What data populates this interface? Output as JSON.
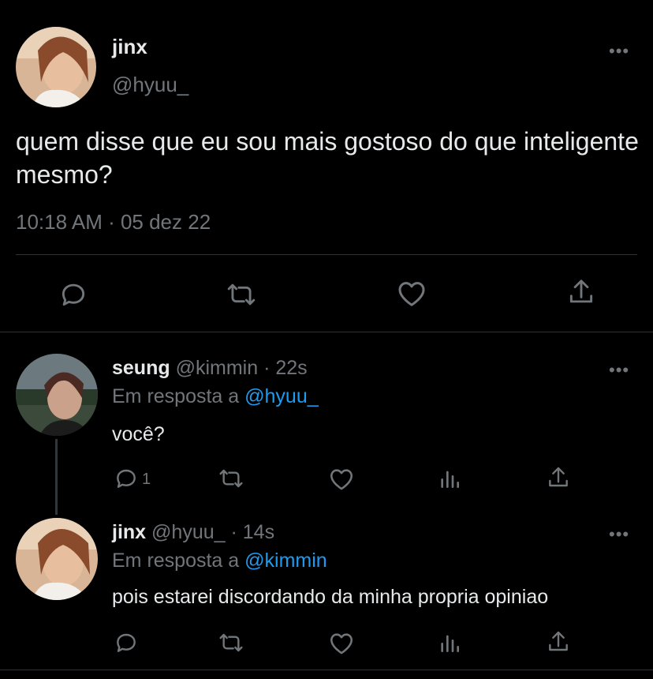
{
  "main_tweet": {
    "author_name": "jinx",
    "author_handle": "@hyuu_",
    "text": "quem disse que eu sou mais gostoso do que inteligente mesmo?",
    "timestamp": "10:18 AM · 05 dez 22",
    "more_icon": "more-horizontal-icon",
    "actions": [
      "reply-icon",
      "retweet-icon",
      "like-icon",
      "share-icon"
    ]
  },
  "replies": [
    {
      "author_name": "seung",
      "author_handle": "@kimmin",
      "time": "· 22s",
      "in_reply_label": "Em resposta a",
      "in_reply_mention": "@hyuu_",
      "text": "você?",
      "reply_count": "1",
      "actions": [
        "reply-icon",
        "retweet-icon",
        "like-icon",
        "analytics-icon",
        "share-icon"
      ]
    },
    {
      "author_name": "jinx",
      "author_handle": "@hyuu_",
      "time": "· 14s",
      "in_reply_label": "Em resposta a",
      "in_reply_mention": "@kimmin",
      "text": "pois estarei discordando da minha propria opiniao",
      "reply_count": "",
      "actions": [
        "reply-icon",
        "retweet-icon",
        "like-icon",
        "analytics-icon",
        "share-icon"
      ]
    }
  ],
  "colors": {
    "background": "#000000",
    "text": "#e7e9ea",
    "secondary": "#71767b",
    "mention": "#1d9bf0",
    "divider": "#2f3336"
  }
}
